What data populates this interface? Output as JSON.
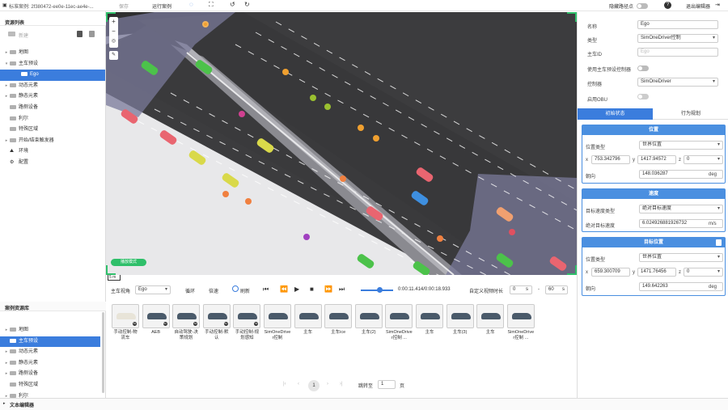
{
  "topbar": {
    "case_label": "标准案例: 2f380472-ee0e-11ec-ae4e-...",
    "save": "保存",
    "run": "运行案例",
    "hide_path": "隐藏路径点",
    "exit_editor": "退出编辑器"
  },
  "left": {
    "resource_title": "资源列表",
    "create": "新建",
    "tree": [
      {
        "label": "地图",
        "arrow": "▸",
        "kind": "folder"
      },
      {
        "label": "主车预设",
        "arrow": "▾",
        "kind": "folder"
      },
      {
        "label": "Ego",
        "arrow": "",
        "kind": "car",
        "selected": true
      },
      {
        "label": "动态元素",
        "arrow": "▸",
        "kind": "folder"
      },
      {
        "label": "静态元素",
        "arrow": "▸",
        "kind": "folder"
      },
      {
        "label": "路侧设备",
        "arrow": "",
        "kind": "folder"
      },
      {
        "label": "利尔",
        "arrow": "",
        "kind": "folder"
      },
      {
        "label": "特殊区域",
        "arrow": "",
        "kind": "folder"
      },
      {
        "label": "开始/结束触发器",
        "arrow": "▸",
        "kind": "folder"
      },
      {
        "label": "环境",
        "arrow": "",
        "kind": "env"
      },
      {
        "label": "配置",
        "arrow": "",
        "kind": "cfg"
      }
    ],
    "case_lib_title": "案例资源库",
    "case_tree": [
      {
        "label": "地图",
        "arrow": "▸"
      },
      {
        "label": "主车预设",
        "arrow": "",
        "selected": true
      },
      {
        "label": "动态元素",
        "arrow": "▸"
      },
      {
        "label": "静态元素",
        "arrow": "▸"
      },
      {
        "label": "路侧设备",
        "arrow": "▸"
      },
      {
        "label": "特殊区域",
        "arrow": ""
      },
      {
        "label": "利尔",
        "arrow": "▸"
      }
    ]
  },
  "map": {
    "scale": "5 m",
    "mode_button": "播放模式"
  },
  "playbar": {
    "view_label": "主车视角",
    "view_value": "Ego",
    "loop": "循环",
    "speed": "倍速",
    "refresh": "刷新",
    "time": "0:00:11.414/0:00:18.933",
    "custom_duration": "自定义视频时长",
    "dur_from": "0",
    "unit_s": "s",
    "dash": "-",
    "dur_to": "60",
    "unit_s2": "s"
  },
  "cases": [
    {
      "label": "手动控制-物流车",
      "badge": "51"
    },
    {
      "label": "AEB",
      "badge": "51"
    },
    {
      "label": "自动驾驶-决策规划",
      "badge": "51"
    },
    {
      "label": "手动控制-默认",
      "badge": "51"
    },
    {
      "label": "手动控制-规划感知",
      "badge": "51"
    },
    {
      "label": "SimOneDriver控制",
      "badge": ""
    },
    {
      "label": "主车",
      "badge": ""
    },
    {
      "label": "主车ice",
      "badge": ""
    },
    {
      "label": "主车(2)",
      "badge": ""
    },
    {
      "label": "SimOneDriver控制 ...",
      "badge": ""
    },
    {
      "label": "主车",
      "badge": ""
    },
    {
      "label": "主车(3)",
      "badge": ""
    },
    {
      "label": "主车",
      "badge": ""
    },
    {
      "label": "SimOneDriver控制 ...",
      "badge": ""
    }
  ],
  "pager": {
    "first": "|‹",
    "prev": "‹",
    "page": "1",
    "next": "›",
    "last": "›|",
    "jump": "跳转至",
    "jump_value": "1",
    "page_unit": "页"
  },
  "right": {
    "name_label": "名称",
    "name_value": "Ego",
    "type_label": "类型",
    "type_value": "SimOneDriver控制",
    "id_label": "主车ID",
    "id_placeholder": "Ego",
    "use_preset_label": "使用主车预设控制器",
    "controller_label": "控制器",
    "controller_value": "SimOneDriver",
    "obu_label": "启用OBU",
    "tab_initial": "初始状态",
    "tab_behavior": "行为规划",
    "pos_title": "位置",
    "pos_type_label": "位置类型",
    "pos_type_value": "世界位置",
    "x_label": "x",
    "x_value": "753.342796",
    "y_label": "y",
    "y_value": "1417.94572",
    "z_label": "z",
    "z_value": "0",
    "heading_label": "朝向",
    "heading_value": "148.036287",
    "deg": "deg",
    "speed_title": "速度",
    "speed_type_label": "目标速度类型",
    "speed_type_value": "绝对目标速度",
    "abs_speed_label": "绝对目标速度",
    "abs_speed_value": "6.024926881926732",
    "speed_unit": "m/s",
    "goal_title": "目标位置",
    "goal_type_label": "位置类型",
    "goal_type_value": "世界位置",
    "gx_value": "659.300709",
    "gy_value": "1471.76456",
    "gz_value": "0",
    "gheading_label": "朝向",
    "gheading_value": "149.642263",
    "deg2": "deg"
  },
  "bottom": {
    "text_editor": "文本编辑器"
  },
  "colors": {
    "accent": "#3b7ddd",
    "green": "#2fbf6a"
  }
}
